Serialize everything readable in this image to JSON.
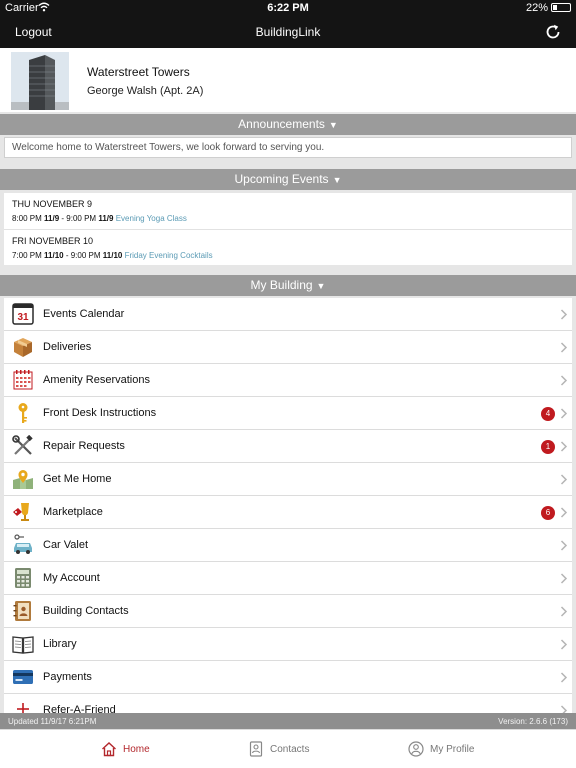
{
  "status_bar": {
    "carrier": "Carrier",
    "time": "6:22 PM",
    "battery": "22%"
  },
  "nav": {
    "logout_label": "Logout",
    "title": "BuildingLink",
    "refresh_icon": "refresh-icon"
  },
  "building": {
    "name": "Waterstreet Towers",
    "resident": "George Walsh (Apt.  2A)",
    "photo_icon": "building-photo"
  },
  "announcements": {
    "header": "Announcements",
    "arrow": "▼",
    "message": "Welcome home to Waterstreet Towers, we look forward to serving you."
  },
  "upcoming": {
    "header": "Upcoming Events",
    "arrow": "▼",
    "events": [
      {
        "day": "THU NOVEMBER 9",
        "start_time": "8:00 PM",
        "start_date": "11/9",
        "sep": "- 9:00 PM",
        "end_date": "11/9",
        "name": "Evening Yoga Class"
      },
      {
        "day": "FRI NOVEMBER 10",
        "start_time": "7:00 PM",
        "start_date": "11/10",
        "sep": "- 9:00 PM",
        "end_date": "11/10",
        "name": "Friday Evening Cocktails"
      }
    ]
  },
  "my_building": {
    "header": "My Building",
    "arrow": "▼",
    "items": [
      {
        "label": "Events Calendar",
        "icon": "calendar-icon",
        "badge": ""
      },
      {
        "label": "Deliveries",
        "icon": "package-icon",
        "badge": ""
      },
      {
        "label": "Amenity Reservations",
        "icon": "reservation-calendar-icon",
        "badge": ""
      },
      {
        "label": "Front Desk Instructions",
        "icon": "key-icon",
        "badge": "4"
      },
      {
        "label": "Repair Requests",
        "icon": "tools-icon",
        "badge": "1"
      },
      {
        "label": "Get Me Home",
        "icon": "map-pin-icon",
        "badge": ""
      },
      {
        "label": "Marketplace",
        "icon": "marketplace-icon",
        "badge": "6"
      },
      {
        "label": "Car Valet",
        "icon": "car-icon",
        "badge": ""
      },
      {
        "label": "My Account",
        "icon": "calculator-icon",
        "badge": ""
      },
      {
        "label": "Building Contacts",
        "icon": "address-book-icon",
        "badge": ""
      },
      {
        "label": "Library",
        "icon": "book-icon",
        "badge": ""
      },
      {
        "label": "Payments",
        "icon": "credit-card-icon",
        "badge": ""
      },
      {
        "label": "Refer-A-Friend",
        "icon": "refer-friend-icon",
        "badge": ""
      }
    ]
  },
  "footer": {
    "updated": "Updated 11/9/17 6:21PM",
    "version": "Version: 2.6.6 (173)"
  },
  "tabs": [
    {
      "label": "Home",
      "icon": "home-icon",
      "active": true
    },
    {
      "label": "Contacts",
      "icon": "contacts-icon",
      "active": false
    },
    {
      "label": "My Profile",
      "icon": "profile-icon",
      "active": false
    }
  ],
  "colors": {
    "accent": "#b3282d",
    "badge": "#c01a1f",
    "section_header": "#9b9b9b",
    "event_link": "#5b9bb5",
    "bar": "#141414"
  }
}
